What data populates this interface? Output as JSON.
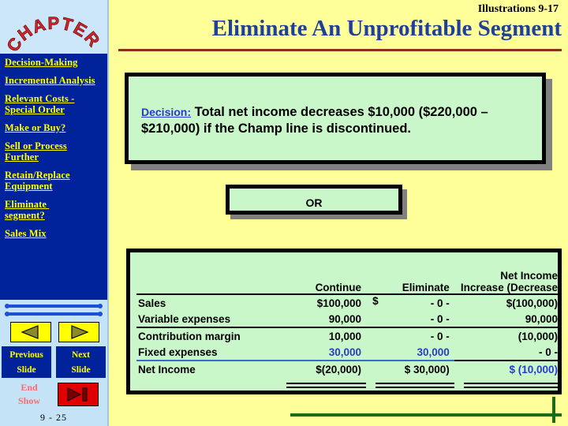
{
  "meta": {
    "illustration_label": "Illustrations 9-17",
    "page_title": "Eliminate An Unprofitable Segment",
    "slide_number": "9 - 25"
  },
  "colors": {
    "page_background": "#FFFF99",
    "sidebar_background": "#C5E3F6",
    "nav_panel_background": "#00239C",
    "nav_link": "#FFFF00",
    "title": "#1F3F9B",
    "title_rule": "#8B2F1A",
    "box_fill": "#C9F7C9",
    "box_border": "#000000",
    "box_shadow": "#808080",
    "accent_blue": "#2B3BC9",
    "end_show_text": "#FF6B6B",
    "end_show_button": "#E00000",
    "footer_line": "#1A6B1A",
    "logo_red": "#D8232A"
  },
  "sidebar": {
    "logo_text": "CHAPTER",
    "items": [
      {
        "label": "Decision-Making"
      },
      {
        "label": "Incremental Analysis"
      },
      {
        "label": "Relevant Costs - Special Order"
      },
      {
        "label": "Make or Buy?"
      },
      {
        "label": "Sell or Process Further"
      },
      {
        "label": "Retain/Replace Equipment"
      },
      {
        "label": "Eliminate \nsegment?"
      },
      {
        "label": "Sales Mix"
      }
    ],
    "controls": {
      "previous_slide_label": "Previous\nSlide",
      "next_slide_label": "Next\nSlide",
      "end_show_label": "End\nShow"
    }
  },
  "decision_box": {
    "label": "Decision:",
    "text": "  Total net income decreases $10,000 ($220,000 – $210,000) if the Champ line is discontinued."
  },
  "or_box": {
    "text": "OR"
  },
  "table": {
    "headers": {
      "label": "",
      "continue": "Continue",
      "eliminate": "Eliminate",
      "net_income_line1": "Net Income",
      "net_income_line2": "Increase (Decrease"
    },
    "rows": [
      {
        "label": "Sales",
        "continue": "$100,000",
        "eliminate_sign": "$",
        "eliminate": "- 0 -",
        "net_income": "$(100,000)",
        "underline": "none",
        "value_color": "black"
      },
      {
        "label": "Variable expenses",
        "continue": "90,000",
        "eliminate_sign": "",
        "eliminate": "- 0 -",
        "net_income": "90,000",
        "underline": "black",
        "value_color": "black"
      },
      {
        "label": "Contribution margin",
        "continue": "10,000",
        "eliminate_sign": "",
        "eliminate": "- 0 -",
        "net_income": "(10,000)",
        "underline": "none",
        "value_color": "black"
      },
      {
        "label": "Fixed expenses",
        "continue": "30,000",
        "eliminate_sign": "",
        "eliminate": "30,000",
        "net_income": "- 0 -",
        "underline": "blue",
        "value_color": "blue"
      },
      {
        "label": "Net Income",
        "continue": "$(20,000)",
        "eliminate_sign": "",
        "eliminate": "$ 30,000)",
        "net_income": "$ (10,000)",
        "underline": "double",
        "value_color": "mixed"
      }
    ]
  }
}
